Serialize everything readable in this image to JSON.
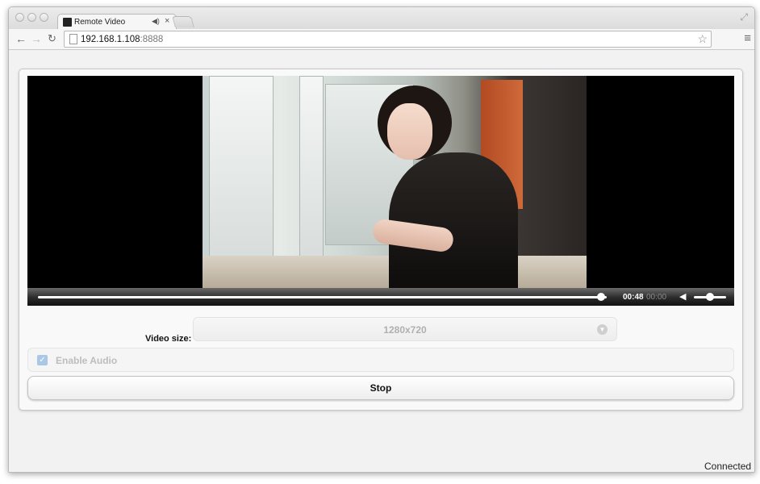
{
  "browser": {
    "tab_title": "Remote Video",
    "tab_close": "×",
    "url_host": "192.168.1.108",
    "url_port": ":8888"
  },
  "player": {
    "time_current": "00:48",
    "time_total": "00:00",
    "progress_fraction": 0.99,
    "volume_fraction": 0.5
  },
  "form": {
    "video_size_label": "Video size:",
    "video_size_value": "1280x720",
    "enable_audio_label": "Enable Audio",
    "enable_audio_checked": true,
    "stop_label": "Stop"
  },
  "status": {
    "text": "Connected"
  },
  "colors": {
    "checkbox": "#aac8e6",
    "video_background": "#000000"
  }
}
